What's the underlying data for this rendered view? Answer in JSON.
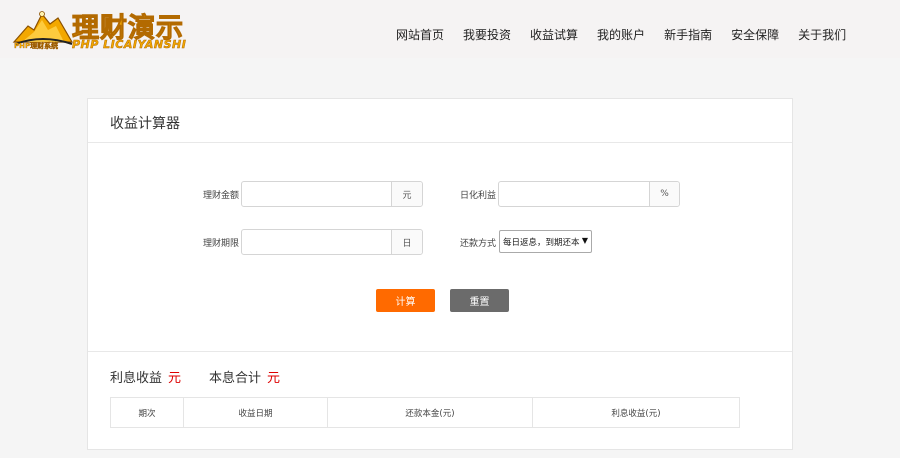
{
  "logo": {
    "main_text": "理财演示",
    "sub_text": "PHP LICAIYANSHI",
    "mini_text": "PHP理财系统"
  },
  "nav": {
    "items": [
      {
        "label": "网站首页"
      },
      {
        "label": "我要投资"
      },
      {
        "label": "收益试算"
      },
      {
        "label": "我的账户"
      },
      {
        "label": "新手指南"
      },
      {
        "label": "安全保障"
      },
      {
        "label": "关于我们"
      }
    ]
  },
  "calculator": {
    "title": "收益计算器",
    "amount": {
      "label": "理财金额",
      "value": "",
      "unit": "元"
    },
    "rate": {
      "label": "日化利益",
      "value": "",
      "unit": "%"
    },
    "period": {
      "label": "理财期限",
      "value": "",
      "unit": "日"
    },
    "repayment": {
      "label": "还款方式",
      "selected": "每日返息，到期还本"
    },
    "calc_button": "计算",
    "reset_button": "重置"
  },
  "summary": {
    "interest_label": "利息收益",
    "interest_unit": "元",
    "total_label": "本息合计",
    "total_unit": "元"
  },
  "table": {
    "headers": [
      "期次",
      "收益日期",
      "还款本金(元)",
      "利息收益(元)"
    ]
  },
  "colors": {
    "accent": "#ff6a00",
    "reset": "#6b6b6b",
    "unit_red": "#dd0000",
    "logo_gold": "#f3a800"
  }
}
